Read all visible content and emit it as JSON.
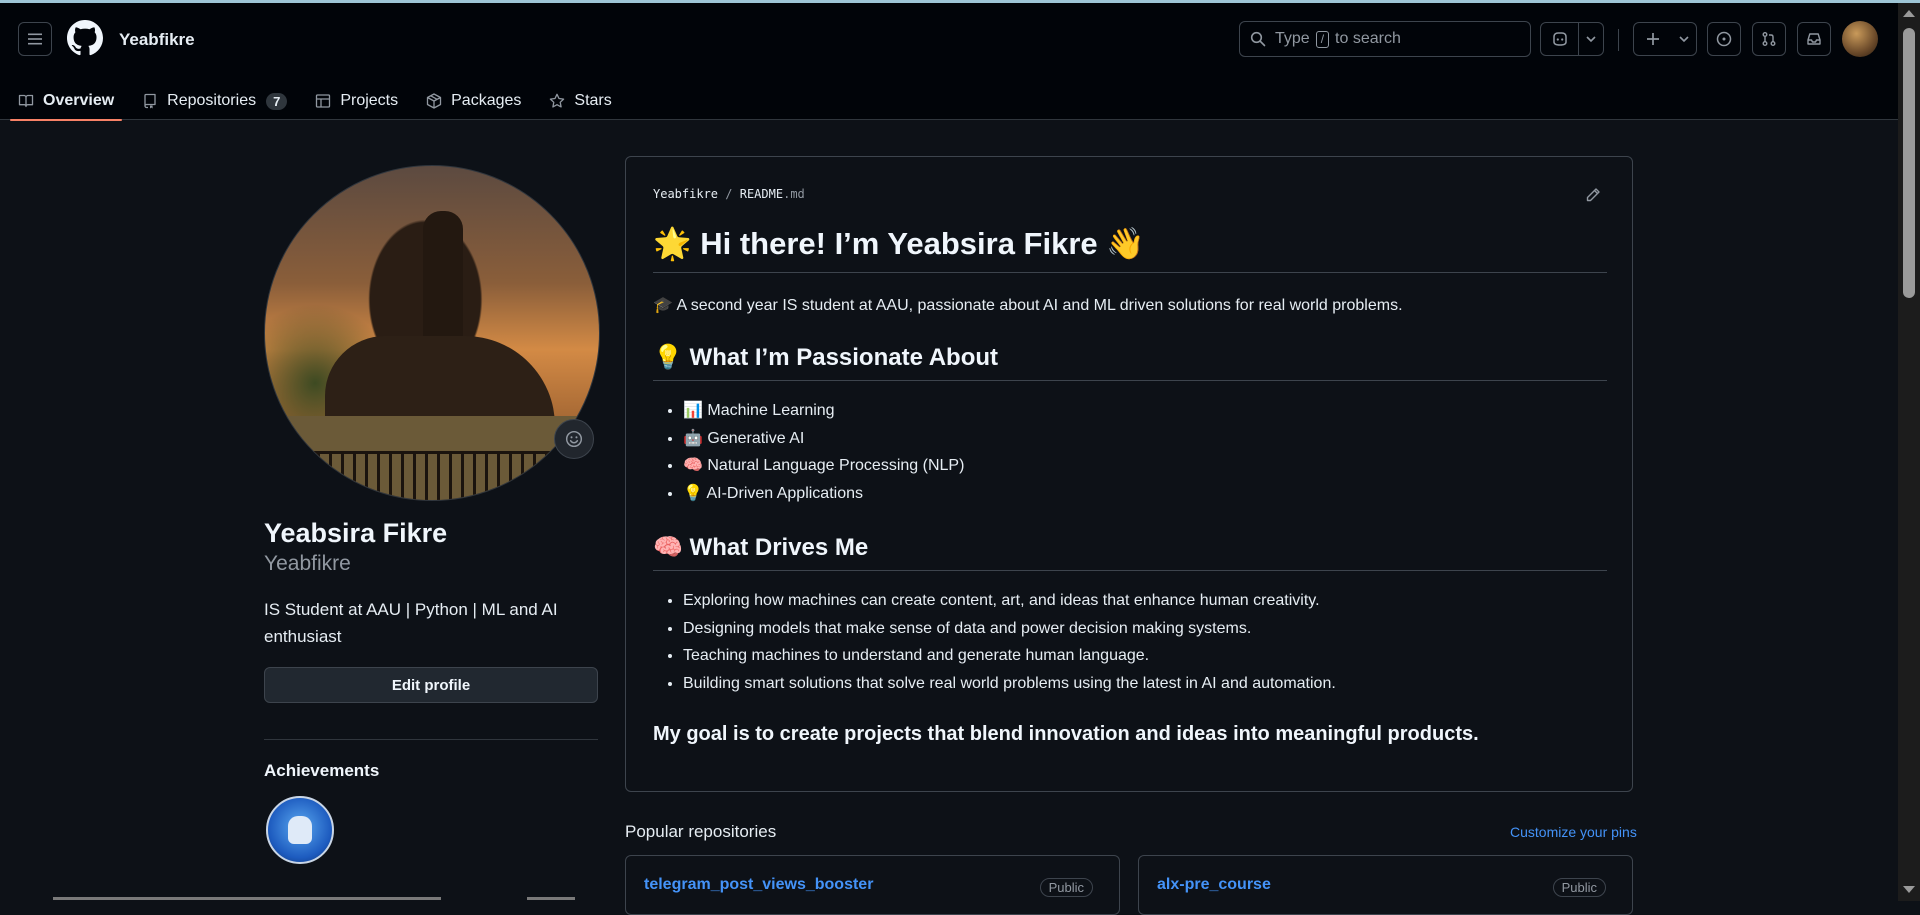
{
  "topbar": {
    "username": "Yeabfikre",
    "search_prefix": "Type",
    "search_key": "/",
    "search_suffix": "to search"
  },
  "tabs": [
    {
      "label": "Overview"
    },
    {
      "label": "Repositories",
      "count": "7"
    },
    {
      "label": "Projects"
    },
    {
      "label": "Packages"
    },
    {
      "label": "Stars"
    }
  ],
  "profile": {
    "fullname": "Yeabsira Fikre",
    "login": "Yeabfikre",
    "bio": "IS Student at AAU | Python | ML and AI enthusiast",
    "edit_label": "Edit profile",
    "achievements_title": "Achievements"
  },
  "readme": {
    "path_user": "Yeabfikre",
    "path_sep": "/",
    "path_file": "README",
    "path_ext": ".md",
    "title": "🌟 Hi there! I’m Yeabsira Fikre 👋",
    "intro": "🎓 A second year IS student at AAU, passionate about AI and ML driven solutions for real world problems.",
    "passion_heading": "💡 What I’m Passionate About",
    "passion_items": [
      "📊 Machine Learning",
      "🤖 Generative AI",
      "🧠 Natural Language Processing (NLP)",
      "💡 AI-Driven Applications"
    ],
    "drives_heading": "🧠 What Drives Me",
    "drives_items": [
      "Exploring how machines can create content, art, and ideas that enhance human creativity.",
      "Designing models that make sense of data and power decision making systems.",
      "Teaching machines to understand and generate human language.",
      "Building smart solutions that solve real world problems using the latest in AI and automation."
    ],
    "goal": "My goal is to create projects that blend innovation and ideas into meaningful products."
  },
  "popular": {
    "title": "Popular repositories",
    "customize": "Customize your pins",
    "repos": [
      {
        "name": "telegram_post_views_booster",
        "visibility": "Public"
      },
      {
        "name": "alx-pre_course",
        "visibility": "Public"
      }
    ]
  },
  "colors": {
    "bg": "#0d1117",
    "header_bg": "#010409",
    "border": "#3d444d",
    "link": "#4493f8",
    "tab_underline": "#f78166"
  }
}
